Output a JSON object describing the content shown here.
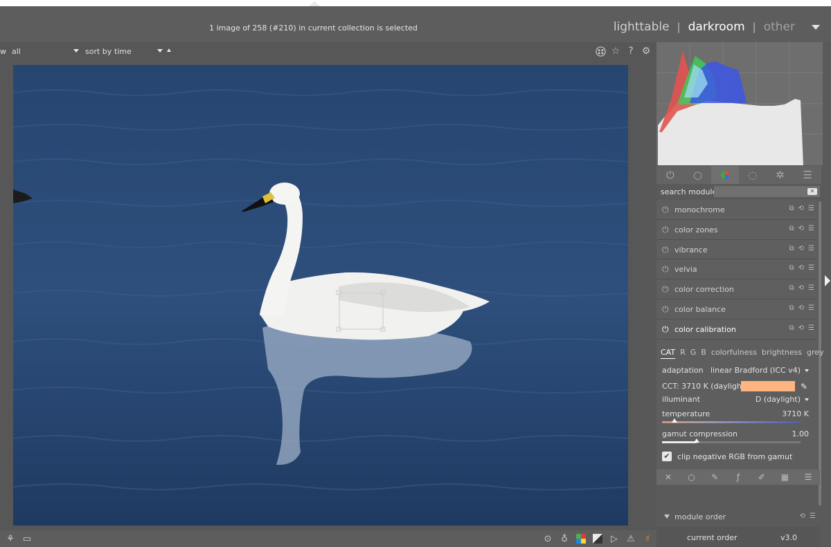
{
  "top": {
    "status_message": "1 image of 258 (#210) in current collection is selected",
    "views": {
      "lighttable": "lighttable",
      "darkroom": "darkroom",
      "other": "other",
      "separator": "|"
    }
  },
  "filterbar": {
    "prefix": "w",
    "filter_value": "all",
    "sort_label": "sort by",
    "sort_value": "time",
    "icons": [
      "color-labels-icon",
      "star-icon",
      "help-icon",
      "settings-icon"
    ]
  },
  "bottombar": {
    "left_icons": [
      "styles-icon",
      "second-window-icon"
    ],
    "right_icons": [
      "focus-peaking-icon",
      "bulb-icon",
      "color-assessment-icon",
      "raw-overexposed-icon",
      "softproof-icon",
      "gamut-check-icon",
      "guides-icon"
    ]
  },
  "panel": {
    "search_label": "search module",
    "modules": [
      {
        "name": "monochrome"
      },
      {
        "name": "color zones"
      },
      {
        "name": "vibrance"
      },
      {
        "name": "velvia"
      },
      {
        "name": "color correction"
      },
      {
        "name": "color balance"
      },
      {
        "name": "color calibration"
      }
    ],
    "color_calibration": {
      "tabs": [
        "CAT",
        "R",
        "G",
        "B",
        "colorfulness",
        "brightness",
        "grey"
      ],
      "active_tab": "CAT",
      "adaptation_label": "adaptation",
      "adaptation_value": "linear Bradford (ICC v4)",
      "cct_label": "CCT: 3710 K (daylight)",
      "cct_swatch_color": "#fdb47f",
      "illuminant_label": "illuminant",
      "illuminant_value": "D (daylight)",
      "temperature_label": "temperature",
      "temperature_value": "3710 K",
      "temperature_level": 0.09,
      "gamut_label": "gamut compression",
      "gamut_value": "1.00",
      "gamut_level": 0.25,
      "clip_label": "clip negative RGB from gamut",
      "clip_checked": true
    },
    "module_order_label": "module order",
    "current_order_label": "current order",
    "current_order_value": "v3.0"
  }
}
